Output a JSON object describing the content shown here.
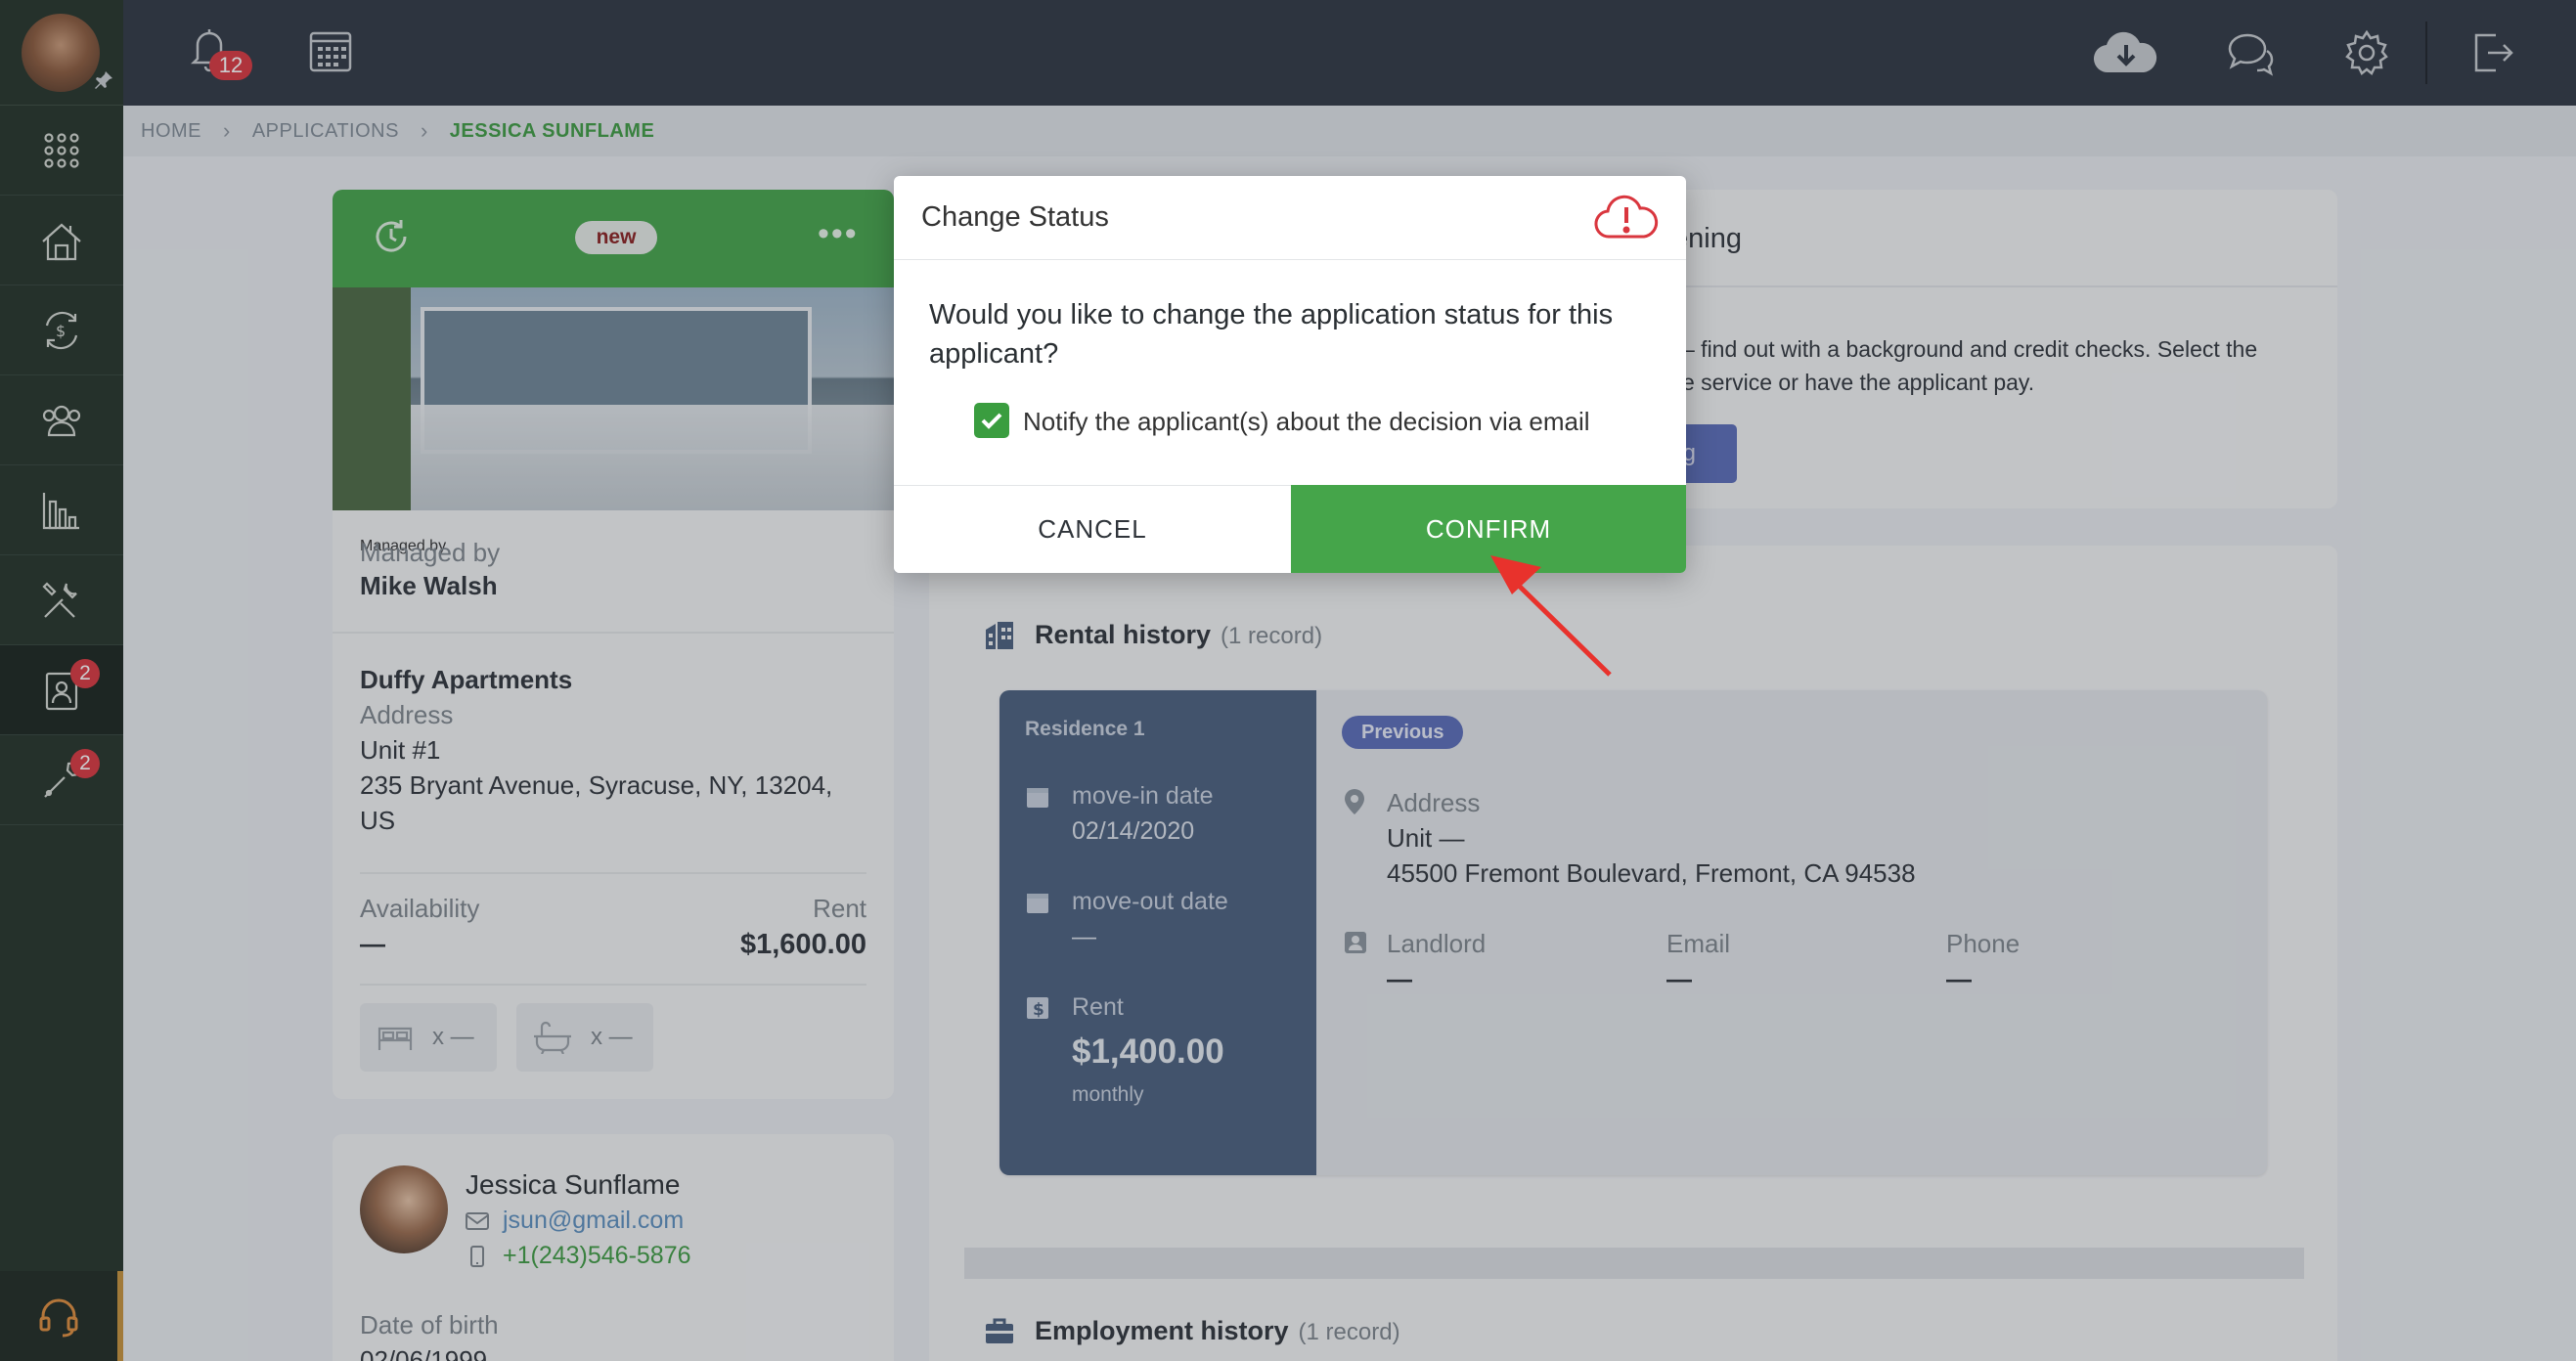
{
  "topbar": {
    "notifications_count": "12"
  },
  "sidebar": {
    "applications_badge": "2",
    "maintenance_badge": "2"
  },
  "breadcrumb": {
    "home": "HOME",
    "applications": "APPLICATIONS",
    "current": "JESSICA SUNFLAME"
  },
  "property": {
    "status_badge": "new",
    "managed_by_label": "Managed by",
    "manager_name": "Mike Walsh",
    "property_name": "Duffy Apartments",
    "address_label": "Address",
    "unit": "Unit #1",
    "address_line": "235 Bryant Avenue, Syracuse, NY, 13204,",
    "country": "US",
    "availability_label": "Availability",
    "availability_value": "—",
    "rent_label": "Rent",
    "rent_value": "$1,600.00",
    "beds": "x —",
    "baths": "x —"
  },
  "applicant": {
    "name": "Jessica Sunflame",
    "email": "jsun@gmail.com",
    "phone": "+1(243)546-5876",
    "dob_label": "Date of birth",
    "dob_value": "02/06/1999"
  },
  "screening": {
    "title_partial": "ening",
    "text_line1": "– find out with a background and credit checks. Select the",
    "text_line2": "e service or have the applicant pay.",
    "button_partial": "g"
  },
  "rental_history": {
    "title": "Rental history",
    "count": "(1 record)",
    "residence_label": "Residence 1",
    "move_in_label": "move-in date",
    "move_in_value": "02/14/2020",
    "move_out_label": "move-out date",
    "move_out_value": "—",
    "rent_label": "Rent",
    "rent_value": "$1,400.00",
    "rent_period": "monthly",
    "previous_badge": "Previous",
    "address_label": "Address",
    "unit": "Unit —",
    "address_line": "45500 Fremont Boulevard, Fremont, CA 94538",
    "landlord_label": "Landlord",
    "landlord_value": "—",
    "email_label": "Email",
    "email_value": "—",
    "phone_label": "Phone",
    "phone_value": "—"
  },
  "employment_history": {
    "title": "Employment history",
    "count": "(1 record)"
  },
  "modal": {
    "title": "Change Status",
    "question": "Would you like to change the application status for this applicant?",
    "notify_label": "Notify the applicant(s) about the decision via email",
    "notify_checked": true,
    "cancel_label": "CANCEL",
    "confirm_label": "CONFIRM"
  },
  "colors": {
    "accent_green": "#45a54a",
    "sidebar": "#243228",
    "topbar": "#2f3742",
    "residence_panel": "#4a5f7d",
    "badge_red": "#d9363e"
  }
}
